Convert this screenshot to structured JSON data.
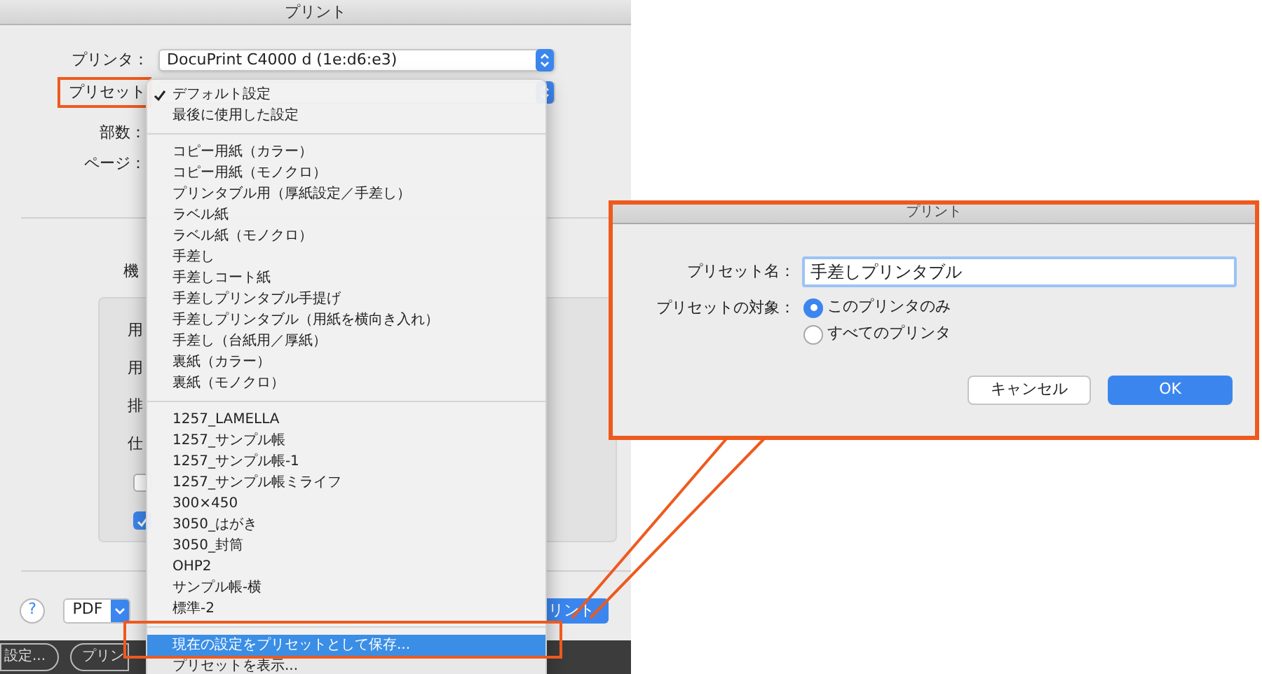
{
  "print_dialog": {
    "title": "プリント",
    "printer": {
      "label": "プリンタ：",
      "value": "DocuPrint C4000 d (1e:d6:e3)"
    },
    "preset": {
      "label": "プリセット"
    },
    "copies": {
      "label": "部数："
    },
    "pages": {
      "label": "ページ："
    },
    "section_label": "機",
    "options_box": {
      "labels": [
        "用",
        "用",
        "排",
        "仕"
      ],
      "checkboxes": [
        {
          "checked": false
        },
        {
          "checked": true
        }
      ]
    },
    "help_button": "?",
    "pdf_button": "PDF",
    "print_button": "リント",
    "bottom_bar": {
      "buttons": [
        "設定...",
        "プリン"
      ]
    }
  },
  "preset_menu": {
    "sections": [
      [
        {
          "label": "デフォルト設定",
          "checked": true,
          "selected": false
        },
        {
          "label": "最後に使用した設定",
          "checked": false,
          "selected": false
        }
      ],
      [
        {
          "label": "コピー用紙（カラー）",
          "checked": false,
          "selected": false
        },
        {
          "label": "コピー用紙（モノクロ）",
          "checked": false,
          "selected": false
        },
        {
          "label": "プリンタブル用（厚紙設定／手差し）",
          "checked": false,
          "selected": false
        },
        {
          "label": "ラベル紙",
          "checked": false,
          "selected": false
        },
        {
          "label": "ラベル紙（モノクロ）",
          "checked": false,
          "selected": false
        },
        {
          "label": "手差し",
          "checked": false,
          "selected": false
        },
        {
          "label": "手差しコート紙",
          "checked": false,
          "selected": false
        },
        {
          "label": "手差しプリンタブル手提げ",
          "checked": false,
          "selected": false
        },
        {
          "label": "手差しプリンタブル（用紙を横向き入れ）",
          "checked": false,
          "selected": false
        },
        {
          "label": "手差し（台紙用／厚紙）",
          "checked": false,
          "selected": false
        },
        {
          "label": "裏紙（カラー）",
          "checked": false,
          "selected": false
        },
        {
          "label": "裏紙（モノクロ）",
          "checked": false,
          "selected": false
        }
      ],
      [
        {
          "label": "1257_LAMELLA",
          "checked": false,
          "selected": false
        },
        {
          "label": "1257_サンプル帳",
          "checked": false,
          "selected": false
        },
        {
          "label": "1257_サンプル帳-1",
          "checked": false,
          "selected": false
        },
        {
          "label": "1257_サンプル帳ミライフ",
          "checked": false,
          "selected": false
        },
        {
          "label": "300×450",
          "checked": false,
          "selected": false
        },
        {
          "label": "3050_はがき",
          "checked": false,
          "selected": false
        },
        {
          "label": "3050_封筒",
          "checked": false,
          "selected": false
        },
        {
          "label": "OHP2",
          "checked": false,
          "selected": false
        },
        {
          "label": "サンプル帳-横",
          "checked": false,
          "selected": false
        },
        {
          "label": "標準-2",
          "checked": false,
          "selected": false
        }
      ],
      [
        {
          "label": "現在の設定をプリセットとして保存...",
          "checked": false,
          "selected": true
        },
        {
          "label": "プリセットを表示...",
          "checked": false,
          "selected": false
        }
      ]
    ]
  },
  "save_preset_dialog": {
    "title": "プリント",
    "name_label": "プリセット名：",
    "name_value": "手差しプリンタブル",
    "target_label": "プリセットの対象：",
    "targets": [
      {
        "label": "このプリンタのみ",
        "selected": true
      },
      {
        "label": "すべてのプリンタ",
        "selected": false
      }
    ],
    "buttons": [
      {
        "label": "キャンセル",
        "kind": "secondary"
      },
      {
        "label": "OK",
        "kind": "primary"
      }
    ]
  }
}
